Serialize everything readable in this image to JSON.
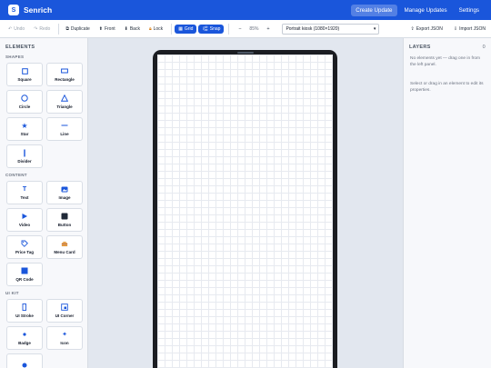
{
  "header": {
    "logo_letter": "S",
    "brand": "Senrich",
    "nav": [
      "Create Update",
      "Manage Updates",
      "Settings"
    ]
  },
  "toolbar": {
    "undo": "Undo",
    "redo": "Redo",
    "duplicate": "Duplicate",
    "front": "Front",
    "back": "Back",
    "lock": "Lock",
    "grid": "Grid",
    "snap": "Snap",
    "zoom_minus": "−",
    "zoom_value": "85%",
    "zoom_plus": "+",
    "device_select": "Portrait kiosk (1080×1920)",
    "export": "Export JSON",
    "import": "Import JSON"
  },
  "elements_panel": {
    "title": "ELEMENTS",
    "sections": [
      {
        "label": "SHAPES",
        "items": [
          "Square",
          "Rectangle",
          "Circle",
          "Triangle",
          "Star",
          "Line",
          "Divider"
        ]
      },
      {
        "label": "CONTENT",
        "items": [
          "Text",
          "Image",
          "Video",
          "Button",
          "Price Tag",
          "Menu Card",
          "QR Code"
        ]
      },
      {
        "label": "UI KIT",
        "items": [
          "UI Stroke",
          "UI Corner",
          "Badge",
          "Icon"
        ]
      }
    ]
  },
  "layers_panel": {
    "title": "LAYERS",
    "count": "0",
    "empty_hint": "No elements yet — drag one in from the left panel.",
    "select_hint": "Select or drag in an element to edit its properties."
  },
  "colors": {
    "primary": "#1a56db",
    "panel_bg": "#f7f8fb",
    "canvas_bg": "#e2e7ef",
    "device": "#1b1d22"
  }
}
